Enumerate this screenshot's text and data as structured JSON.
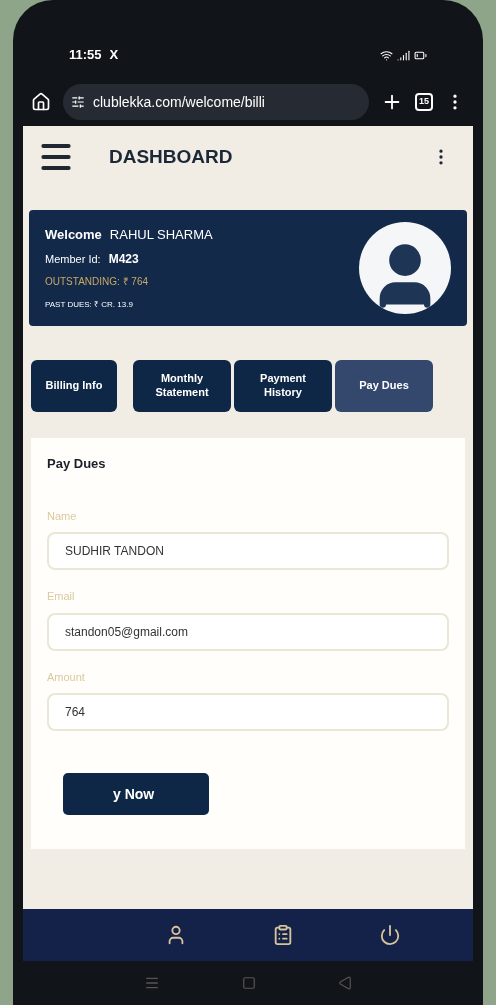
{
  "status_bar": {
    "time": "11:55",
    "notification": "X"
  },
  "browser": {
    "url": "clublekka.com/welcome/billi",
    "tab_count": "15"
  },
  "header": {
    "title": "DASHBOARD"
  },
  "profile": {
    "greeting": "Welcome",
    "name": "RAHUL SHARMA",
    "member_label": "Member Id:",
    "member_id": "M423",
    "outstanding": "OUTSTANDING: ₹ 764",
    "past_dues": "PAST DUES: ₹ CR. 13.9"
  },
  "tabs": [
    {
      "label": "Billing Info",
      "selected": false
    },
    {
      "label": "Monthly Statement",
      "selected": false
    },
    {
      "label": "Payment History",
      "selected": false
    },
    {
      "label": "Pay Dues",
      "selected": true
    }
  ],
  "form": {
    "title": "Pay Dues",
    "fields": [
      {
        "label": "Name",
        "value": "SUDHIR TANDON"
      },
      {
        "label": "Email",
        "value": "standon05@gmail.com"
      },
      {
        "label": "Amount",
        "value": "764"
      }
    ],
    "submit": "y Now"
  }
}
